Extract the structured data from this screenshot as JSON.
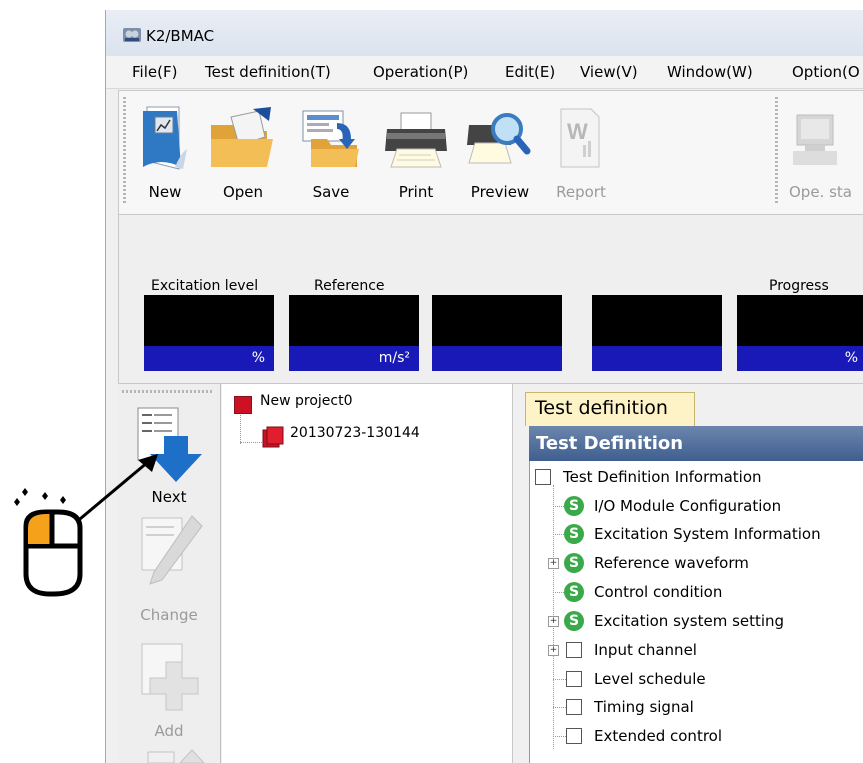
{
  "window": {
    "title": "K2/BMAC",
    "app_icon": "bmac-app-icon"
  },
  "menu": [
    "File(F)",
    "Test definition(T)",
    "Operation(P)",
    "Edit(E)",
    "View(V)",
    "Window(W)",
    "Option(O"
  ],
  "toolbar": {
    "buttons": [
      {
        "label": "New",
        "icon": "new-document-icon",
        "enabled": true
      },
      {
        "label": "Open",
        "icon": "open-folder-icon",
        "enabled": true
      },
      {
        "label": "Save",
        "icon": "save-icon",
        "enabled": true
      },
      {
        "label": "Print",
        "icon": "printer-icon",
        "enabled": true
      },
      {
        "label": "Preview",
        "icon": "print-preview-icon",
        "enabled": true
      },
      {
        "label": "Report",
        "icon": "word-report-icon",
        "enabled": false
      },
      {
        "label": "Ope. sta",
        "icon": "operation-start-icon",
        "enabled": false
      }
    ]
  },
  "status_panel": {
    "labels": {
      "excitation": "Excitation level",
      "reference": "Reference",
      "progress": "Progress"
    },
    "units": {
      "percent": "%",
      "ms2": "m/s²",
      "progress_percent": "%"
    }
  },
  "sidebar": {
    "next_label": "Next",
    "change_label": "Change",
    "add_label": "Add"
  },
  "project_tree": {
    "project": "New project0",
    "child": "20130723-130144"
  },
  "right_pane": {
    "tab_label": "Test definition",
    "header": "Test Definition",
    "nodes": [
      {
        "label": "Test Definition Information",
        "icon": "checkbox",
        "level": 0,
        "expander": false
      },
      {
        "label": "I/O Module Configuration",
        "icon": "s-status-icon",
        "level": 1,
        "expander": false
      },
      {
        "label": "Excitation System Information",
        "icon": "s-status-icon",
        "level": 1,
        "expander": false
      },
      {
        "label": "Reference waveform",
        "icon": "s-status-icon",
        "level": 1,
        "expander": true
      },
      {
        "label": "Control condition",
        "icon": "s-status-icon",
        "level": 1,
        "expander": false
      },
      {
        "label": "Excitation system setting",
        "icon": "s-status-icon",
        "level": 1,
        "expander": true
      },
      {
        "label": "Input channel",
        "icon": "checkbox",
        "level": 1,
        "expander": true
      },
      {
        "label": "Level schedule",
        "icon": "checkbox",
        "level": 1,
        "expander": false
      },
      {
        "label": "Timing signal",
        "icon": "checkbox",
        "level": 1,
        "expander": false
      },
      {
        "label": "Extended control",
        "icon": "checkbox",
        "level": 1,
        "expander": false
      }
    ],
    "s_glyph": "S"
  },
  "colors": {
    "accent_blue": "#1e6fc8",
    "display_blue": "#1919b8",
    "status_green": "#3aa94a",
    "project_red": "#cc1122",
    "mouse_orange": "#f5a11a"
  },
  "annotation": {
    "icon": "mouse-left-click-icon"
  }
}
